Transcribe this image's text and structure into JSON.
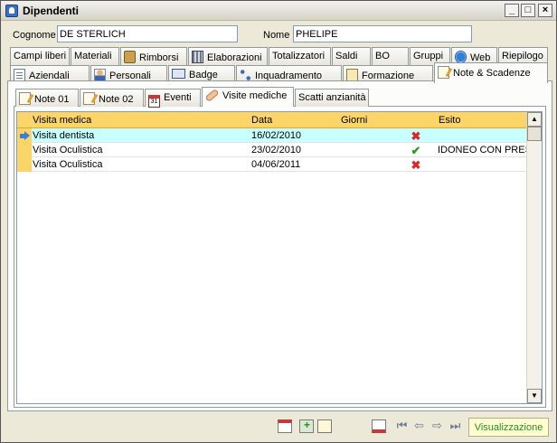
{
  "window": {
    "title": "Dipendenti"
  },
  "fields": {
    "cognome_label": "Cognome",
    "cognome_value": "DE STERLICH",
    "nome_label": "Nome",
    "nome_value": "PHELIPE"
  },
  "tabs_row1": [
    {
      "label": "Campi liberi",
      "icon": ""
    },
    {
      "label": "Materiali",
      "icon": ""
    },
    {
      "label": "Rimborsi",
      "icon": "coins-icon"
    },
    {
      "label": "Elaborazioni",
      "icon": "calculator-icon"
    },
    {
      "label": "Totalizzatori",
      "icon": ""
    },
    {
      "label": "Saldi",
      "icon": ""
    },
    {
      "label": "BO",
      "icon": ""
    },
    {
      "label": "Gruppi",
      "icon": ""
    },
    {
      "label": "Web",
      "icon": "web-icon"
    },
    {
      "label": "Riepilogo",
      "icon": ""
    }
  ],
  "tabs_row2": [
    {
      "label": "Aziendali",
      "icon": "document-icon"
    },
    {
      "label": "Personali",
      "icon": "person-icon"
    },
    {
      "label": "Badge",
      "icon": "badge-icon"
    },
    {
      "label": "Inquadramento",
      "icon": "hierarchy-icon"
    },
    {
      "label": "Formazione",
      "icon": "form-icon"
    },
    {
      "label": "Note & Scadenze",
      "icon": "note-icon",
      "active": true
    }
  ],
  "subtabs": [
    {
      "label": "Note 01",
      "icon": "note-icon"
    },
    {
      "label": "Note 02",
      "icon": "note-icon"
    },
    {
      "label": "Eventi",
      "icon": "calendar-icon",
      "icon_text": "31"
    },
    {
      "label": "Visite mediche",
      "icon": "bandage-icon",
      "active": true
    },
    {
      "label": "Scatti anzianità",
      "icon": ""
    }
  ],
  "grid": {
    "columns": [
      "Visita medica",
      "Data",
      "Giorni",
      "Esito"
    ],
    "rows": [
      {
        "visita": "Visita dentista",
        "data": "16/02/2010",
        "giorni": "",
        "esito_mark": "x",
        "esito": "",
        "selected": true
      },
      {
        "visita": "Visita Oculistica",
        "data": "23/02/2010",
        "giorni": "",
        "esito_mark": "ok",
        "esito": "IDONEO CON PRESCRIZIONI"
      },
      {
        "visita": "Visita Oculistica",
        "data": "04/06/2011",
        "giorni": "",
        "esito_mark": "x",
        "esito": ""
      }
    ],
    "scroll_up": "▲",
    "scroll_down": "▼"
  },
  "window_buttons": {
    "minimize": "_",
    "maximize": "□",
    "close": "×"
  },
  "status": {
    "mode": "Visualizzazione",
    "color": "#2a8a2a"
  },
  "colors": {
    "header": "#fcd56a",
    "selected_row": "#c8ffff",
    "x_mark": "#d42a2a",
    "ok_mark": "#2e9a2e"
  }
}
